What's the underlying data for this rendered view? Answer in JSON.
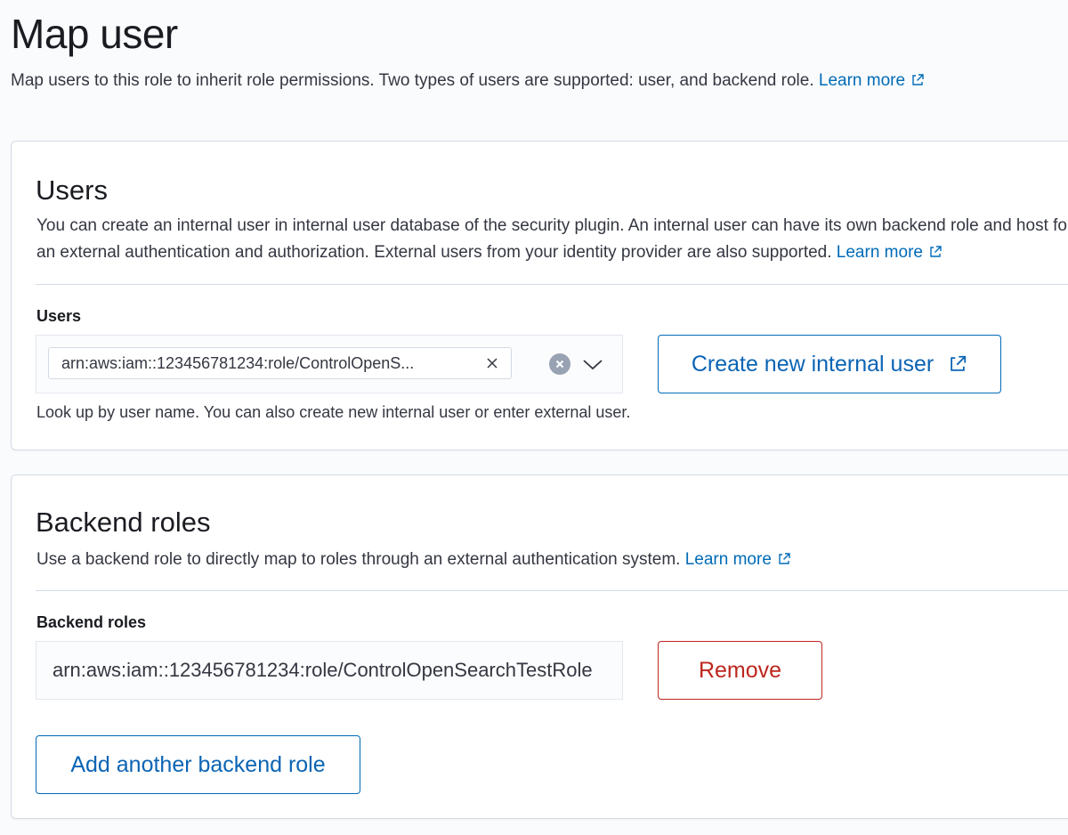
{
  "page": {
    "title": "Map user",
    "description": "Map users to this role to inherit role permissions. Two types of users are supported: user, and backend role.",
    "learn_more": "Learn more"
  },
  "users_panel": {
    "title": "Users",
    "description": "You can create an internal user in internal user database of the security plugin. An internal user can have its own backend role and host for an external authentication and authorization. External users from your identity provider are also supported.",
    "learn_more": "Learn more",
    "field_label": "Users",
    "selected_user": "arn:aws:iam::123456781234:role/ControlOpenS...",
    "create_button": "Create new internal user",
    "help_text": "Look up by user name. You can also create new internal user or enter external user."
  },
  "backend_panel": {
    "title": "Backend roles",
    "description": "Use a backend role to directly map to roles through an external authentication system.",
    "learn_more": "Learn more",
    "field_label": "Backend roles",
    "role_value": "arn:aws:iam::123456781234:role/ControlOpenSearchTestRole",
    "remove_button": "Remove",
    "add_button": "Add another backend role"
  },
  "colors": {
    "link": "#006bb8",
    "danger": "#bd271e",
    "border": "#d3dae6"
  },
  "icons": {
    "external_link": "external-link-icon",
    "clear": "clear-icon",
    "remove_pill": "close-icon",
    "dropdown": "chevron-down-icon"
  }
}
